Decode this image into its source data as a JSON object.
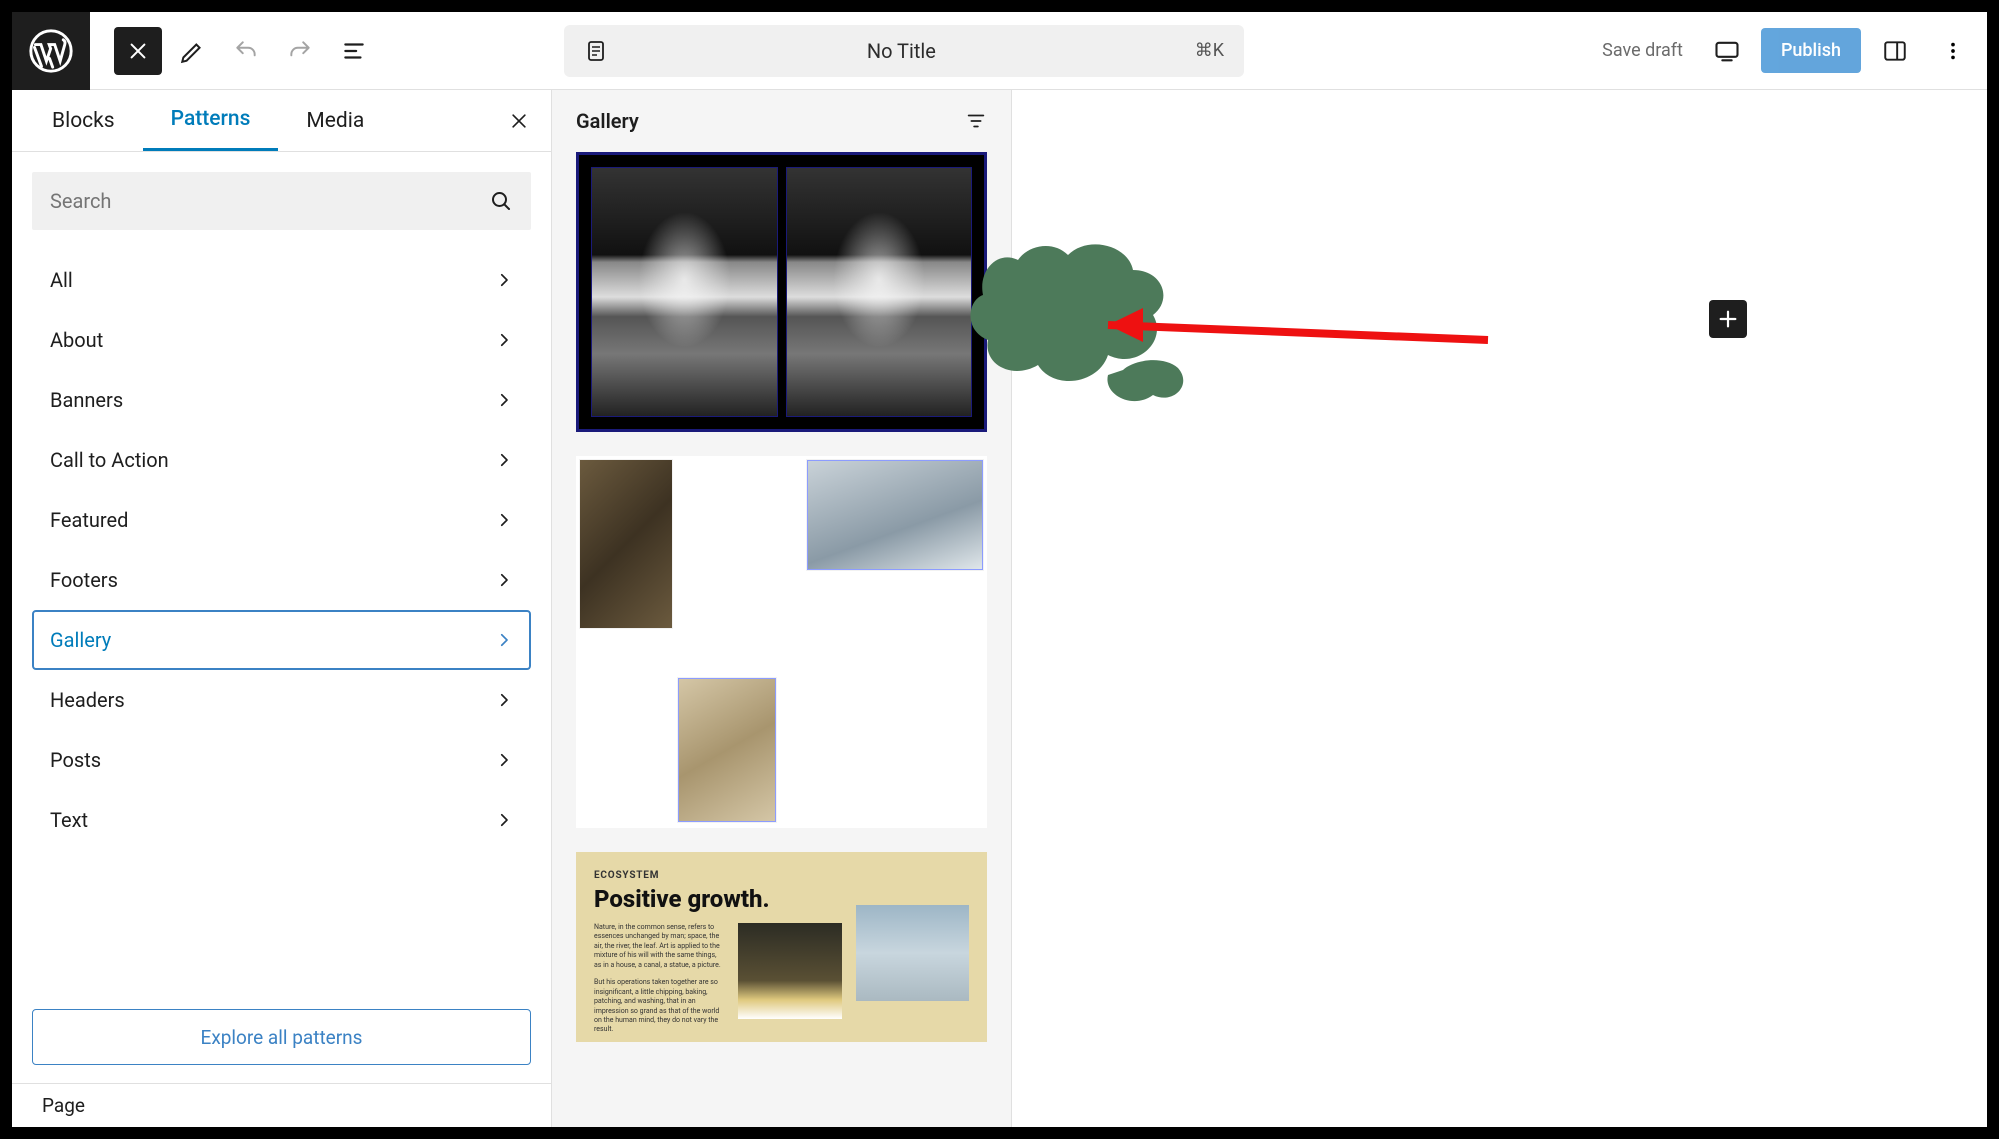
{
  "toolbar": {
    "doc_title": "No Title",
    "shortcut": "⌘K",
    "save_draft": "Save draft",
    "publish": "Publish"
  },
  "inserter": {
    "tabs": [
      "Blocks",
      "Patterns",
      "Media"
    ],
    "active_tab": "Patterns",
    "search_placeholder": "Search",
    "categories": [
      "All",
      "About",
      "Banners",
      "Call to Action",
      "Featured",
      "Footers",
      "Gallery",
      "Headers",
      "Posts",
      "Text"
    ],
    "active_category": "Gallery",
    "explore_label": "Explore all patterns"
  },
  "preview": {
    "title": "Gallery",
    "pattern3": {
      "kicker": "ECOSYSTEM",
      "headline": "Positive growth.",
      "para1": "Nature, in the common sense, refers to essences unchanged by man; space, the air, the river, the leaf. Art is applied to the mixture of his will with the same things, as in a house, a canal, a statue, a picture.",
      "para2": "But his operations taken together are so insignificant, a little chipping, baking, patching, and washing, that in an impression so grand as that of the world on the human mind, they do not vary the result."
    }
  },
  "status": {
    "breadcrumb": "Page"
  }
}
